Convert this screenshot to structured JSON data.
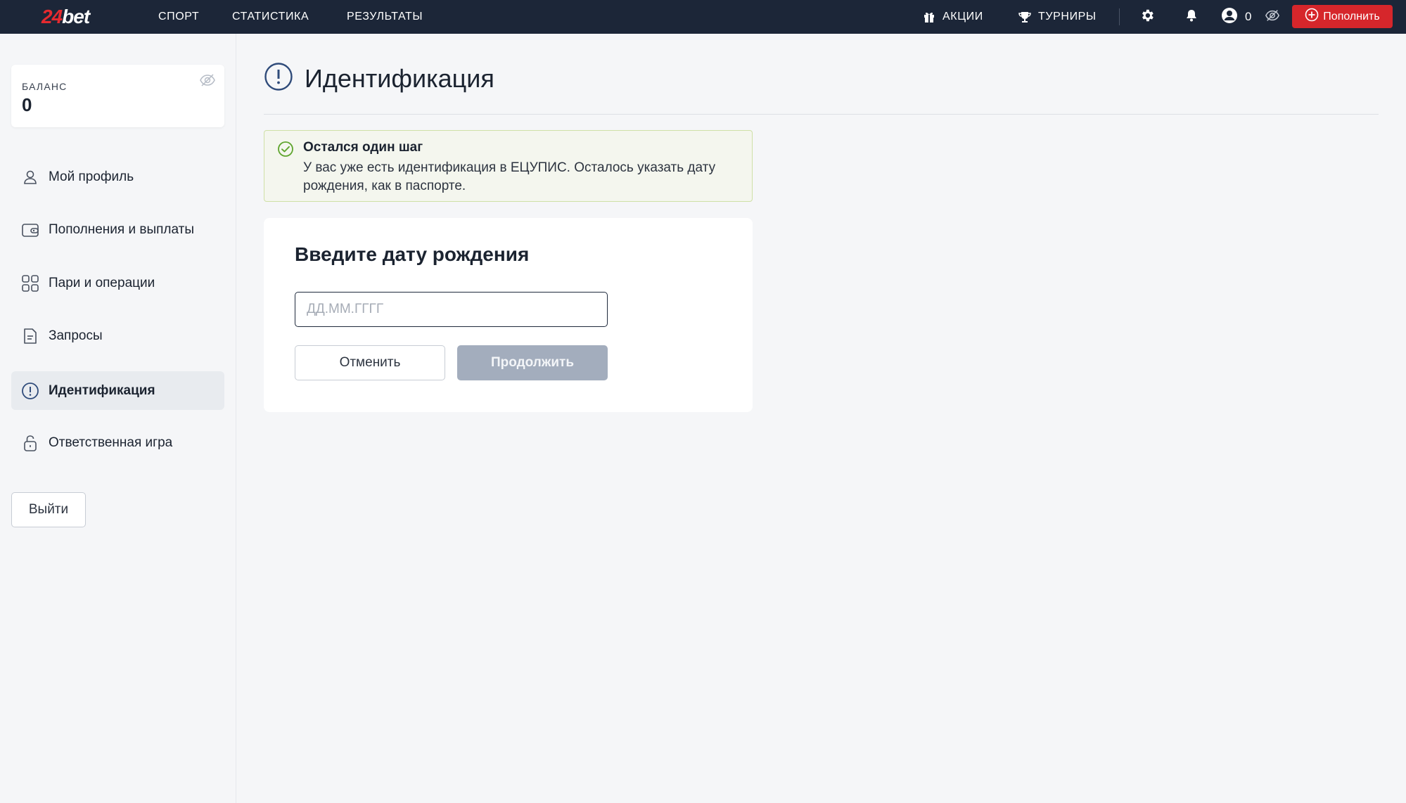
{
  "colors": {
    "topbar": "#1c2638",
    "brand_red": "#e52a2f",
    "deposit": "#d6262b",
    "success": "#5fa52e",
    "disabled_button": "#a3adbd"
  },
  "logo": {
    "num": "24",
    "word": "bet"
  },
  "nav": {
    "sport": "СПОРТ",
    "stats": "СТАТИСТИКА",
    "results": "РЕЗУЛЬТАТЫ",
    "promos": {
      "label": "АКЦИИ",
      "icon": "gift-icon"
    },
    "tournaments": {
      "label": "ТУРНИРЫ",
      "icon": "trophy-icon"
    }
  },
  "top": {
    "balance": "0",
    "deposit_label": "Пополнить"
  },
  "sidebar": {
    "balance_label": "БАЛАНС",
    "balance_value": "0",
    "items": [
      {
        "label": "Мой профиль",
        "icon": "user-icon"
      },
      {
        "label": "Пополнения и выплаты",
        "icon": "wallet-icon"
      },
      {
        "label": "Пари и операции",
        "icon": "grid-icon"
      },
      {
        "label": "Запросы",
        "icon": "document-icon"
      },
      {
        "label": "Идентификация",
        "icon": "alert-circle-icon",
        "active": true
      },
      {
        "label": "Ответственная игра",
        "icon": "lock-icon"
      }
    ],
    "logout_label": "Выйти"
  },
  "main": {
    "title": "Идентификация",
    "alert": {
      "title": "Остался один шаг",
      "text": "У вас уже есть идентификация в ЕЦУПИС. Осталось указать дату рождения, как в паспорте."
    },
    "form": {
      "title": "Введите дату рождения",
      "date_placeholder": "ДД.ММ.ГГГГ",
      "date_value": "",
      "cancel_label": "Отменить",
      "continue_label": "Продолжить"
    }
  }
}
